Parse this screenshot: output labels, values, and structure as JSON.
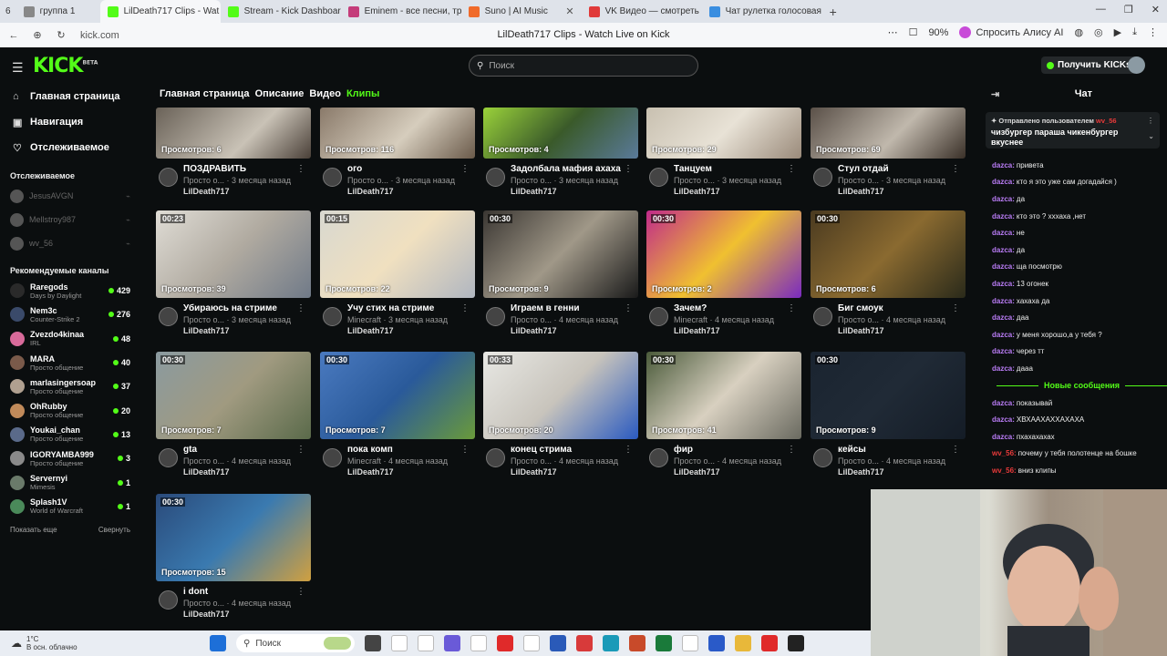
{
  "browser": {
    "tab_count": "6",
    "tabs": [
      {
        "label": "группа 1",
        "color": "#888888"
      },
      {
        "label": "LilDeath717 Clips - Wat",
        "color": "#53fc18"
      },
      {
        "label": "Stream - Kick Dashboard",
        "color": "#53fc18"
      },
      {
        "label": "Eminem - все песни, трек",
        "color": "#c43c7a"
      },
      {
        "label": "Suno | AI Music",
        "color": "#f06a2a"
      },
      {
        "label": "VK Видео — смотреть он",
        "color": "#e03a3a"
      },
      {
        "label": "Чат рулетка голосовая —",
        "color": "#3a8ee0"
      }
    ],
    "url": "kick.com",
    "page_title": "LilDeath717 Clips - Watch Live on Kick",
    "zoom": "90%",
    "alice_label": "Спросить Алису AI"
  },
  "header": {
    "logo": "KICK",
    "logo_badge": "BETA",
    "search_placeholder": "Поиск",
    "kicks_button": "Получить KICKs"
  },
  "sidebar": {
    "nav": [
      {
        "label": "Главная страница",
        "icon": "home-icon"
      },
      {
        "label": "Навигация",
        "icon": "compass-icon"
      },
      {
        "label": "Отслеживаемое",
        "icon": "heart-icon"
      }
    ],
    "following_title": "Отслеживаемое",
    "following": [
      {
        "name": "JesusAVGN"
      },
      {
        "name": "Mellstroy987"
      },
      {
        "name": "wv_56"
      }
    ],
    "recommended_title": "Рекомендуемые каналы",
    "recommended": [
      {
        "name": "Raregods",
        "category": "Days by Daylight",
        "viewers": "429",
        "color": "#2a2a2a"
      },
      {
        "name": "Nem3c",
        "category": "Counter-Strike 2",
        "viewers": "276",
        "color": "#3a4a6a"
      },
      {
        "name": "Zvezdo4kinaa",
        "category": "IRL",
        "viewers": "48",
        "color": "#d86a9a"
      },
      {
        "name": "MARA",
        "category": "Просто общение",
        "viewers": "40",
        "color": "#7a5a4a"
      },
      {
        "name": "marlasingersoap",
        "category": "Просто общение",
        "viewers": "37",
        "color": "#b0a090"
      },
      {
        "name": "OhRubby",
        "category": "Просто общение",
        "viewers": "20",
        "color": "#c08a5a"
      },
      {
        "name": "Youkai_chan",
        "category": "Просто общение",
        "viewers": "13",
        "color": "#5a6a8a"
      },
      {
        "name": "IGORYAMBA999",
        "category": "Просто общение",
        "viewers": "3",
        "color": "#8a8a8a"
      },
      {
        "name": "Servernyi",
        "category": "Mimesis",
        "viewers": "1",
        "color": "#6a7a6a"
      },
      {
        "name": "Splash1V",
        "category": "World of Warcraft",
        "viewers": "1",
        "color": "#4a8a5a"
      }
    ],
    "show_more": "Показать еще",
    "collapse": "Свернуть"
  },
  "channel_tabs": [
    {
      "label": "Главная страница"
    },
    {
      "label": "Описание"
    },
    {
      "label": "Видео"
    },
    {
      "label": "Клипы"
    }
  ],
  "clips": [
    {
      "duration": "",
      "views": "Просмотров: 6",
      "title": "ПОЗДРАВИТЬ",
      "meta": "Просто о... · 3 месяца назад",
      "streamer": "LilDeath717",
      "bg": "linear-gradient(135deg,#6a6258,#c9c2b6 60%,#4a4038)"
    },
    {
      "duration": "",
      "views": "Просмотров: 116",
      "title": "ого",
      "meta": "Просто о... · 3 месяца назад",
      "streamer": "LilDeath717",
      "bg": "linear-gradient(135deg,#8a7a6a,#d6cdbd 55%,#6a5a4a)"
    },
    {
      "duration": "",
      "views": "Просмотров: 4",
      "title": "Задолбала мафия ахаха",
      "meta": "Просто о... · 3 месяца назад",
      "streamer": "LilDeath717",
      "bg": "linear-gradient(135deg,#9ad23a,#3a5a2a 50%,#5a7a9a)"
    },
    {
      "duration": "",
      "views": "Просмотров: 29",
      "title": "Танцуем",
      "meta": "Просто о... · 3 месяца назад",
      "streamer": "LilDeath717",
      "bg": "linear-gradient(135deg,#c8c0b0,#e8e2d6 50%,#9a8a7a)"
    },
    {
      "duration": "",
      "views": "Просмотров: 69",
      "title": "Стул отдай",
      "meta": "Просто о... · 3 месяца назад",
      "streamer": "LilDeath717",
      "bg": "linear-gradient(135deg,#5a5048,#c0b8ac 55%,#3a3028)"
    },
    {
      "duration": "00:23",
      "views": "Просмотров: 39",
      "title": "Убираюсь на стриме",
      "meta": "Просто о... · 3 месяца назад",
      "streamer": "LilDeath717",
      "bg": "linear-gradient(135deg,#e0ddd6,#b0aaa0 50%,#707a88)"
    },
    {
      "duration": "00:15",
      "views": "Просмотров: 22",
      "title": "Учу стих на стриме",
      "meta": "Minecraft · 3 месяца назад",
      "streamer": "LilDeath717",
      "bg": "linear-gradient(135deg,#d8d8d0,#f0e0c0 50%,#b0b6c0)"
    },
    {
      "duration": "00:30",
      "views": "Просмотров: 9",
      "title": "Играем в генни",
      "meta": "Просто о... · 4 месяца назад",
      "streamer": "LilDeath717",
      "bg": "linear-gradient(135deg,#3a3632,#a09888 50%,#1a1a1a)"
    },
    {
      "duration": "00:30",
      "views": "Просмотров: 2",
      "title": "Зачем?",
      "meta": "Minecraft · 4 месяца назад",
      "streamer": "LilDeath717",
      "bg": "linear-gradient(135deg,#c02a8a,#f0c030 50%,#7a2ac0)"
    },
    {
      "duration": "00:30",
      "views": "Просмотров: 6",
      "title": "Биг смоук",
      "meta": "Просто о... · 4 месяца назад",
      "streamer": "LilDeath717",
      "bg": "linear-gradient(135deg,#4a3a20,#8a6a30 50%,#2a2a1a)"
    },
    {
      "duration": "00:30",
      "views": "Просмотров: 7",
      "title": "gta",
      "meta": "Просто о... · 4 месяца назад",
      "streamer": "LilDeath717",
      "bg": "linear-gradient(135deg,#8a9aa0,#a09a80 50%,#5a6a4a)"
    },
    {
      "duration": "00:30",
      "views": "Просмотров: 7",
      "title": "пока комп",
      "meta": "Minecraft · 4 месяца назад",
      "streamer": "LilDeath717",
      "bg": "linear-gradient(135deg,#4a7ac0,#2a5a9a 50%,#6a9a3a)"
    },
    {
      "duration": "00:33",
      "views": "Просмотров: 20",
      "title": "конец стрима",
      "meta": "Просто о... · 4 месяца назад",
      "streamer": "LilDeath717",
      "bg": "linear-gradient(135deg,#e8e8e4,#c8c4bc 50%,#2a5ac0)"
    },
    {
      "duration": "00:30",
      "views": "Просмотров: 41",
      "title": "фир",
      "meta": "Просто о... · 4 месяца назад",
      "streamer": "LilDeath717",
      "bg": "linear-gradient(135deg,#4a5a3a,#d8d0c0 50%,#6a6a60)"
    },
    {
      "duration": "00:30",
      "views": "Просмотров: 9",
      "title": "кейсы",
      "meta": "Просто о... · 4 месяца назад",
      "streamer": "LilDeath717",
      "bg": "linear-gradient(135deg,#1a2430,#202a36 50%,#141c26)"
    },
    {
      "duration": "00:30",
      "views": "Просмотров: 15",
      "title": "i dont",
      "meta": "Просто о... · 4 месяца назад",
      "streamer": "LilDeath717",
      "bg": "linear-gradient(135deg,#2a4a7a,#3a7ab0 50%,#d0a040)"
    }
  ],
  "chat": {
    "title": "Чат",
    "pinned_by_prefix": "Отправлено пользователем",
    "pinned_by_user": "wv_56",
    "pinned_message": "чизбургер параша чикенбургер вкуснее",
    "messages": [
      {
        "user": "dazca:",
        "text": "привета",
        "red": false
      },
      {
        "user": "dazca:",
        "text": "кто я это уже сам догадайся )",
        "red": false
      },
      {
        "user": "dazca:",
        "text": "да",
        "red": false
      },
      {
        "user": "dazca:",
        "text": "кто это ? хххаха ,нет",
        "red": false
      },
      {
        "user": "dazca:",
        "text": "не",
        "red": false
      },
      {
        "user": "dazca:",
        "text": "да",
        "red": false
      },
      {
        "user": "dazca:",
        "text": "ща посмотрю",
        "red": false
      },
      {
        "user": "dazca:",
        "text": "13 огонек",
        "red": false
      },
      {
        "user": "dazca:",
        "text": "хахаха да",
        "red": false
      },
      {
        "user": "dazca:",
        "text": "даа",
        "red": false
      },
      {
        "user": "dazca:",
        "text": "у меня хорошо,а у тебя ?",
        "red": false
      },
      {
        "user": "dazca:",
        "text": "через тт",
        "red": false
      },
      {
        "user": "dazca:",
        "text": "дааа",
        "red": false
      }
    ],
    "new_messages_label": "Новые сообщения",
    "new_messages": [
      {
        "user": "dazca:",
        "text": "показывай",
        "red": false
      },
      {
        "user": "dazca:",
        "text": "ХВХААХАХХАХАХА",
        "red": false
      },
      {
        "user": "dazca:",
        "text": "пхахахахах",
        "red": false
      },
      {
        "user": "wv_56:",
        "text": "почему у тебя полотенце на бошке",
        "red": true
      },
      {
        "user": "wv_56:",
        "text": "вниз клипы",
        "red": true
      }
    ]
  },
  "taskbar": {
    "temperature": "1°C",
    "weather": "В осн. облачно",
    "search": "Поиск"
  }
}
